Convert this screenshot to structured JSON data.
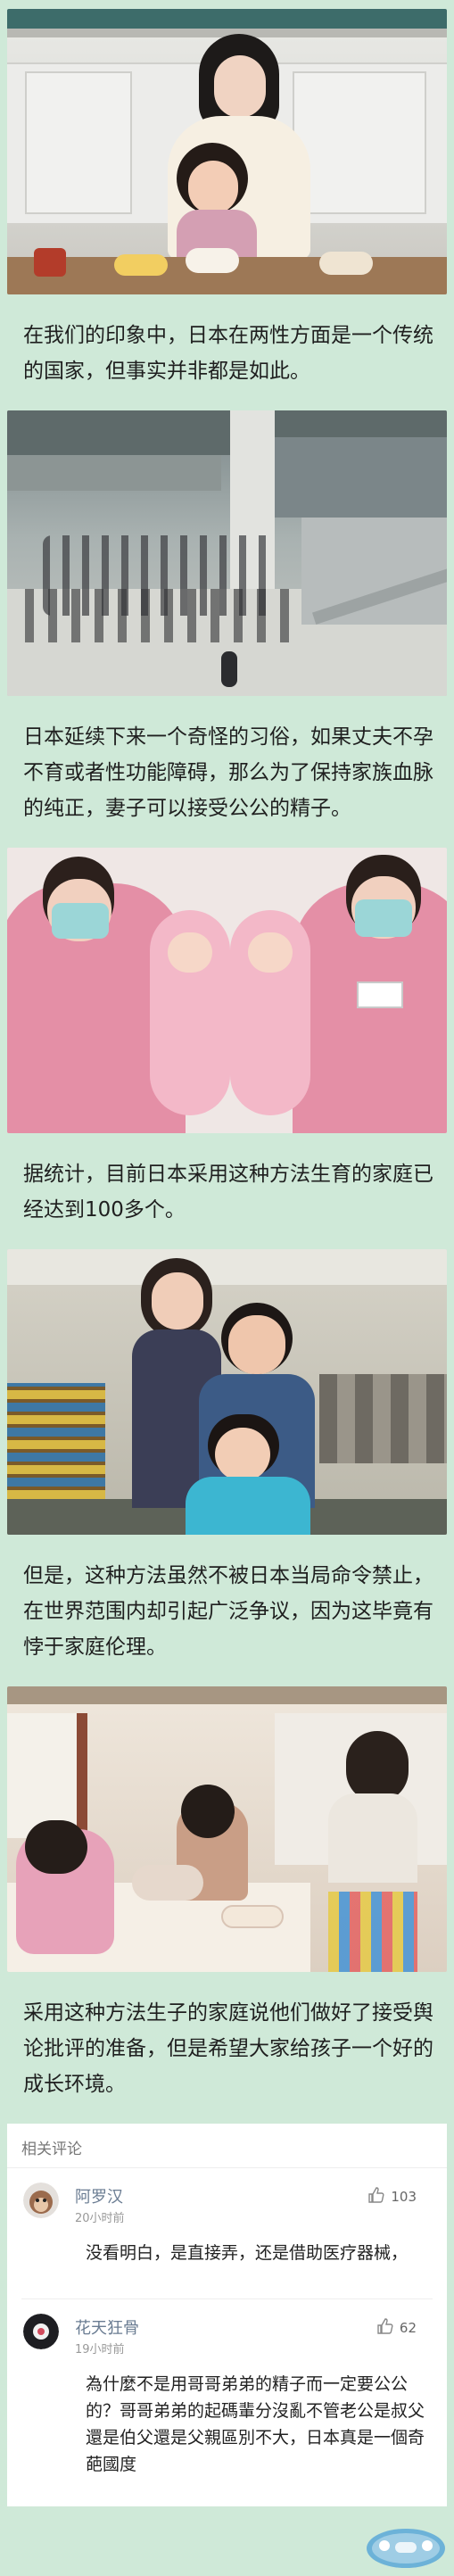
{
  "paragraphs": [
    "在我们的印象中，日本在两性方面是一个传统的国家，但事实并非都是如此。",
    "日本延续下来一个奇怪的习俗，如果丈夫不孕不育或者性功能障碍，那么为了保持家族血脉的纯正，妻子可以接受公公的精子。",
    "据统计，目前日本采用这种方法生育的家庭已经达到100多个。",
    "但是，这种方法虽然不被日本当局命令禁止，在世界范围内却引起广泛争议，因为这毕竟有悖于家庭伦理。",
    "采用这种方法生子的家庭说他们做好了接受舆论批评的准备，但是希望大家给孩子一个好的成长环境。"
  ],
  "comments_section": {
    "header": "相关评论",
    "comments": [
      {
        "name": "阿罗汉",
        "time": "20小时前",
        "likes": "103",
        "body": "没看明白，是直接弄，还是借助医疗器械，"
      },
      {
        "name": "花天狂骨",
        "time": "19小时前",
        "likes": "62",
        "body": "為什麼不是用哥哥弟弟的精子而一定要公公的？哥哥弟弟的起碼輩分沒亂不管老公是叔父還是伯父還是父親區別不大，日本真是一個奇葩國度"
      }
    ]
  },
  "icons": {
    "like": "thumbs-up-icon",
    "avatar1": "avatar-monkey-icon",
    "avatar2": "avatar-flower-icon"
  },
  "colors": {
    "background": "#cfe9d8",
    "name": "#6a7c92"
  }
}
